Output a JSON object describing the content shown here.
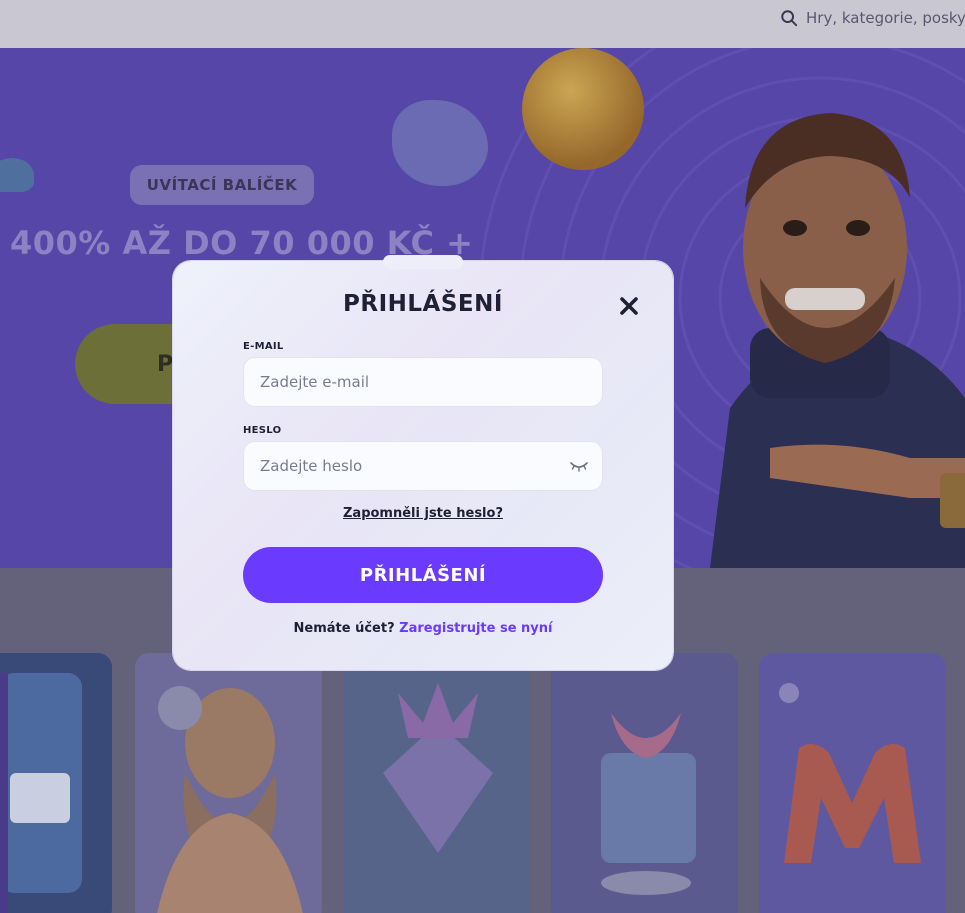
{
  "header": {
    "search_placeholder": "Hry, kategorie, posky",
    "search_icon": "search-icon"
  },
  "hero": {
    "badge": "UVÍTACÍ BALÍČEK",
    "title": "400% AŽ DO 70 000 KČ +",
    "button_label": "P"
  },
  "modal": {
    "title": "PŘIHLÁŠENÍ",
    "close_icon": "close-icon",
    "email": {
      "label": "E-MAIL",
      "placeholder": "Zadejte e-mail",
      "value": ""
    },
    "password": {
      "label": "HESLO",
      "placeholder": "Zadejte heslo",
      "value": "",
      "toggle_icon": "eye-closed-icon"
    },
    "forgot_label": "Zapomněli jste heslo?",
    "submit_label": "PŘIHLÁŠENÍ",
    "register_prompt": "Nemáte účet?",
    "register_link": "Zaregistrujte se nyní"
  },
  "colors": {
    "accent": "#6a3aff",
    "overlay": "#6a6880",
    "hero_bg": "#5546a8"
  }
}
